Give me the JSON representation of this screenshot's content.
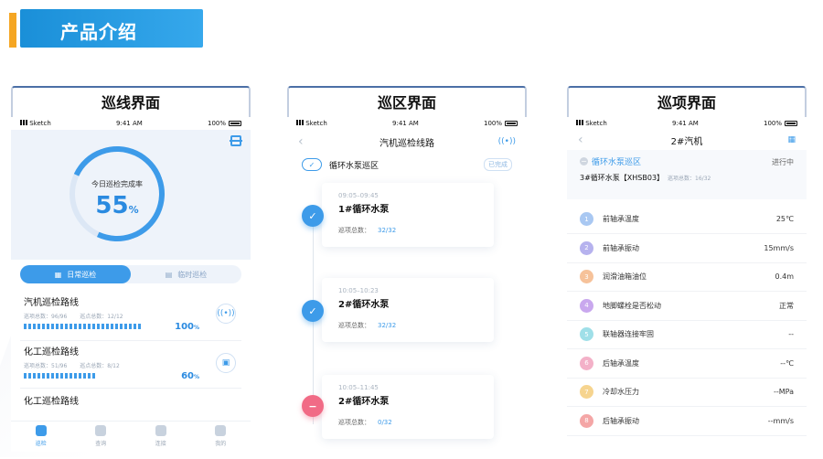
{
  "header": {
    "title": "产品介绍"
  },
  "status": {
    "carrier": "Sketch",
    "time": "9:41 AM",
    "battery": "100%"
  },
  "card1": {
    "title": "巡线界面",
    "ring_label": "今日巡检完成率",
    "ring_value": "55",
    "ring_unit": "%",
    "ring_fraction": 0.55,
    "tab_daily": "日常巡检",
    "tab_temp": "临时巡检",
    "routes": [
      {
        "name": "汽机巡检路线",
        "items": "巡项总数：96/96",
        "points": "巡点总数：12/12",
        "pct": "100",
        "unit": "%"
      },
      {
        "name": "化工巡检路线",
        "items": "巡项总数：51/96",
        "points": "巡点总数：8/12",
        "pct": "60",
        "unit": "%"
      },
      {
        "name": "化工巡检路线"
      }
    ],
    "tabbar": [
      "巡检",
      "查询",
      "连接",
      "我的"
    ]
  },
  "card2": {
    "title": "巡区界面",
    "nav_title": "汽机巡检线路",
    "zone": "循环水泵巡区",
    "zone_status": "已完成",
    "tasks": [
      {
        "time": "09:05–09:45",
        "name": "1#循环水泵",
        "meta_label": "巡项总数：",
        "meta_value": "32/32",
        "state": "done"
      },
      {
        "time": "10:05–10:23",
        "name": "2#循环水泵",
        "meta_label": "巡项总数：",
        "meta_value": "32/32",
        "state": "done"
      },
      {
        "time": "10:05–11:45",
        "name": "2#循环水泵",
        "meta_label": "巡项总数：",
        "meta_value": "0/32",
        "state": "pending"
      }
    ]
  },
  "card3": {
    "title": "巡项界面",
    "nav_title": "2#汽机",
    "zone": "循环水泵巡区",
    "zone_state": "进行中",
    "pump": "3#循环水泵【XHSB03】",
    "pump_meta": "巡项总数：16/32",
    "items": [
      {
        "no": "1",
        "label": "前轴承温度",
        "value": "25℃",
        "color": "#a9c8f2"
      },
      {
        "no": "2",
        "label": "前轴承振动",
        "value": "15mm/s",
        "color": "#b6b2ee"
      },
      {
        "no": "3",
        "label": "润滑油箱油位",
        "value": "0.4m",
        "color": "#f6c29a"
      },
      {
        "no": "4",
        "label": "地脚螺栓是否松动",
        "value": "正常",
        "color": "#c9a8ee"
      },
      {
        "no": "5",
        "label": "联轴器连接牢固",
        "value": "--",
        "color": "#9fdfe8"
      },
      {
        "no": "6",
        "label": "后轴承温度",
        "value": "--℃",
        "color": "#f3b1c8"
      },
      {
        "no": "7",
        "label": "冷却水压力",
        "value": "--MPa",
        "color": "#f6d48f"
      },
      {
        "no": "8",
        "label": "后轴承振动",
        "value": "--mm/s",
        "color": "#f4a6a6"
      }
    ]
  }
}
